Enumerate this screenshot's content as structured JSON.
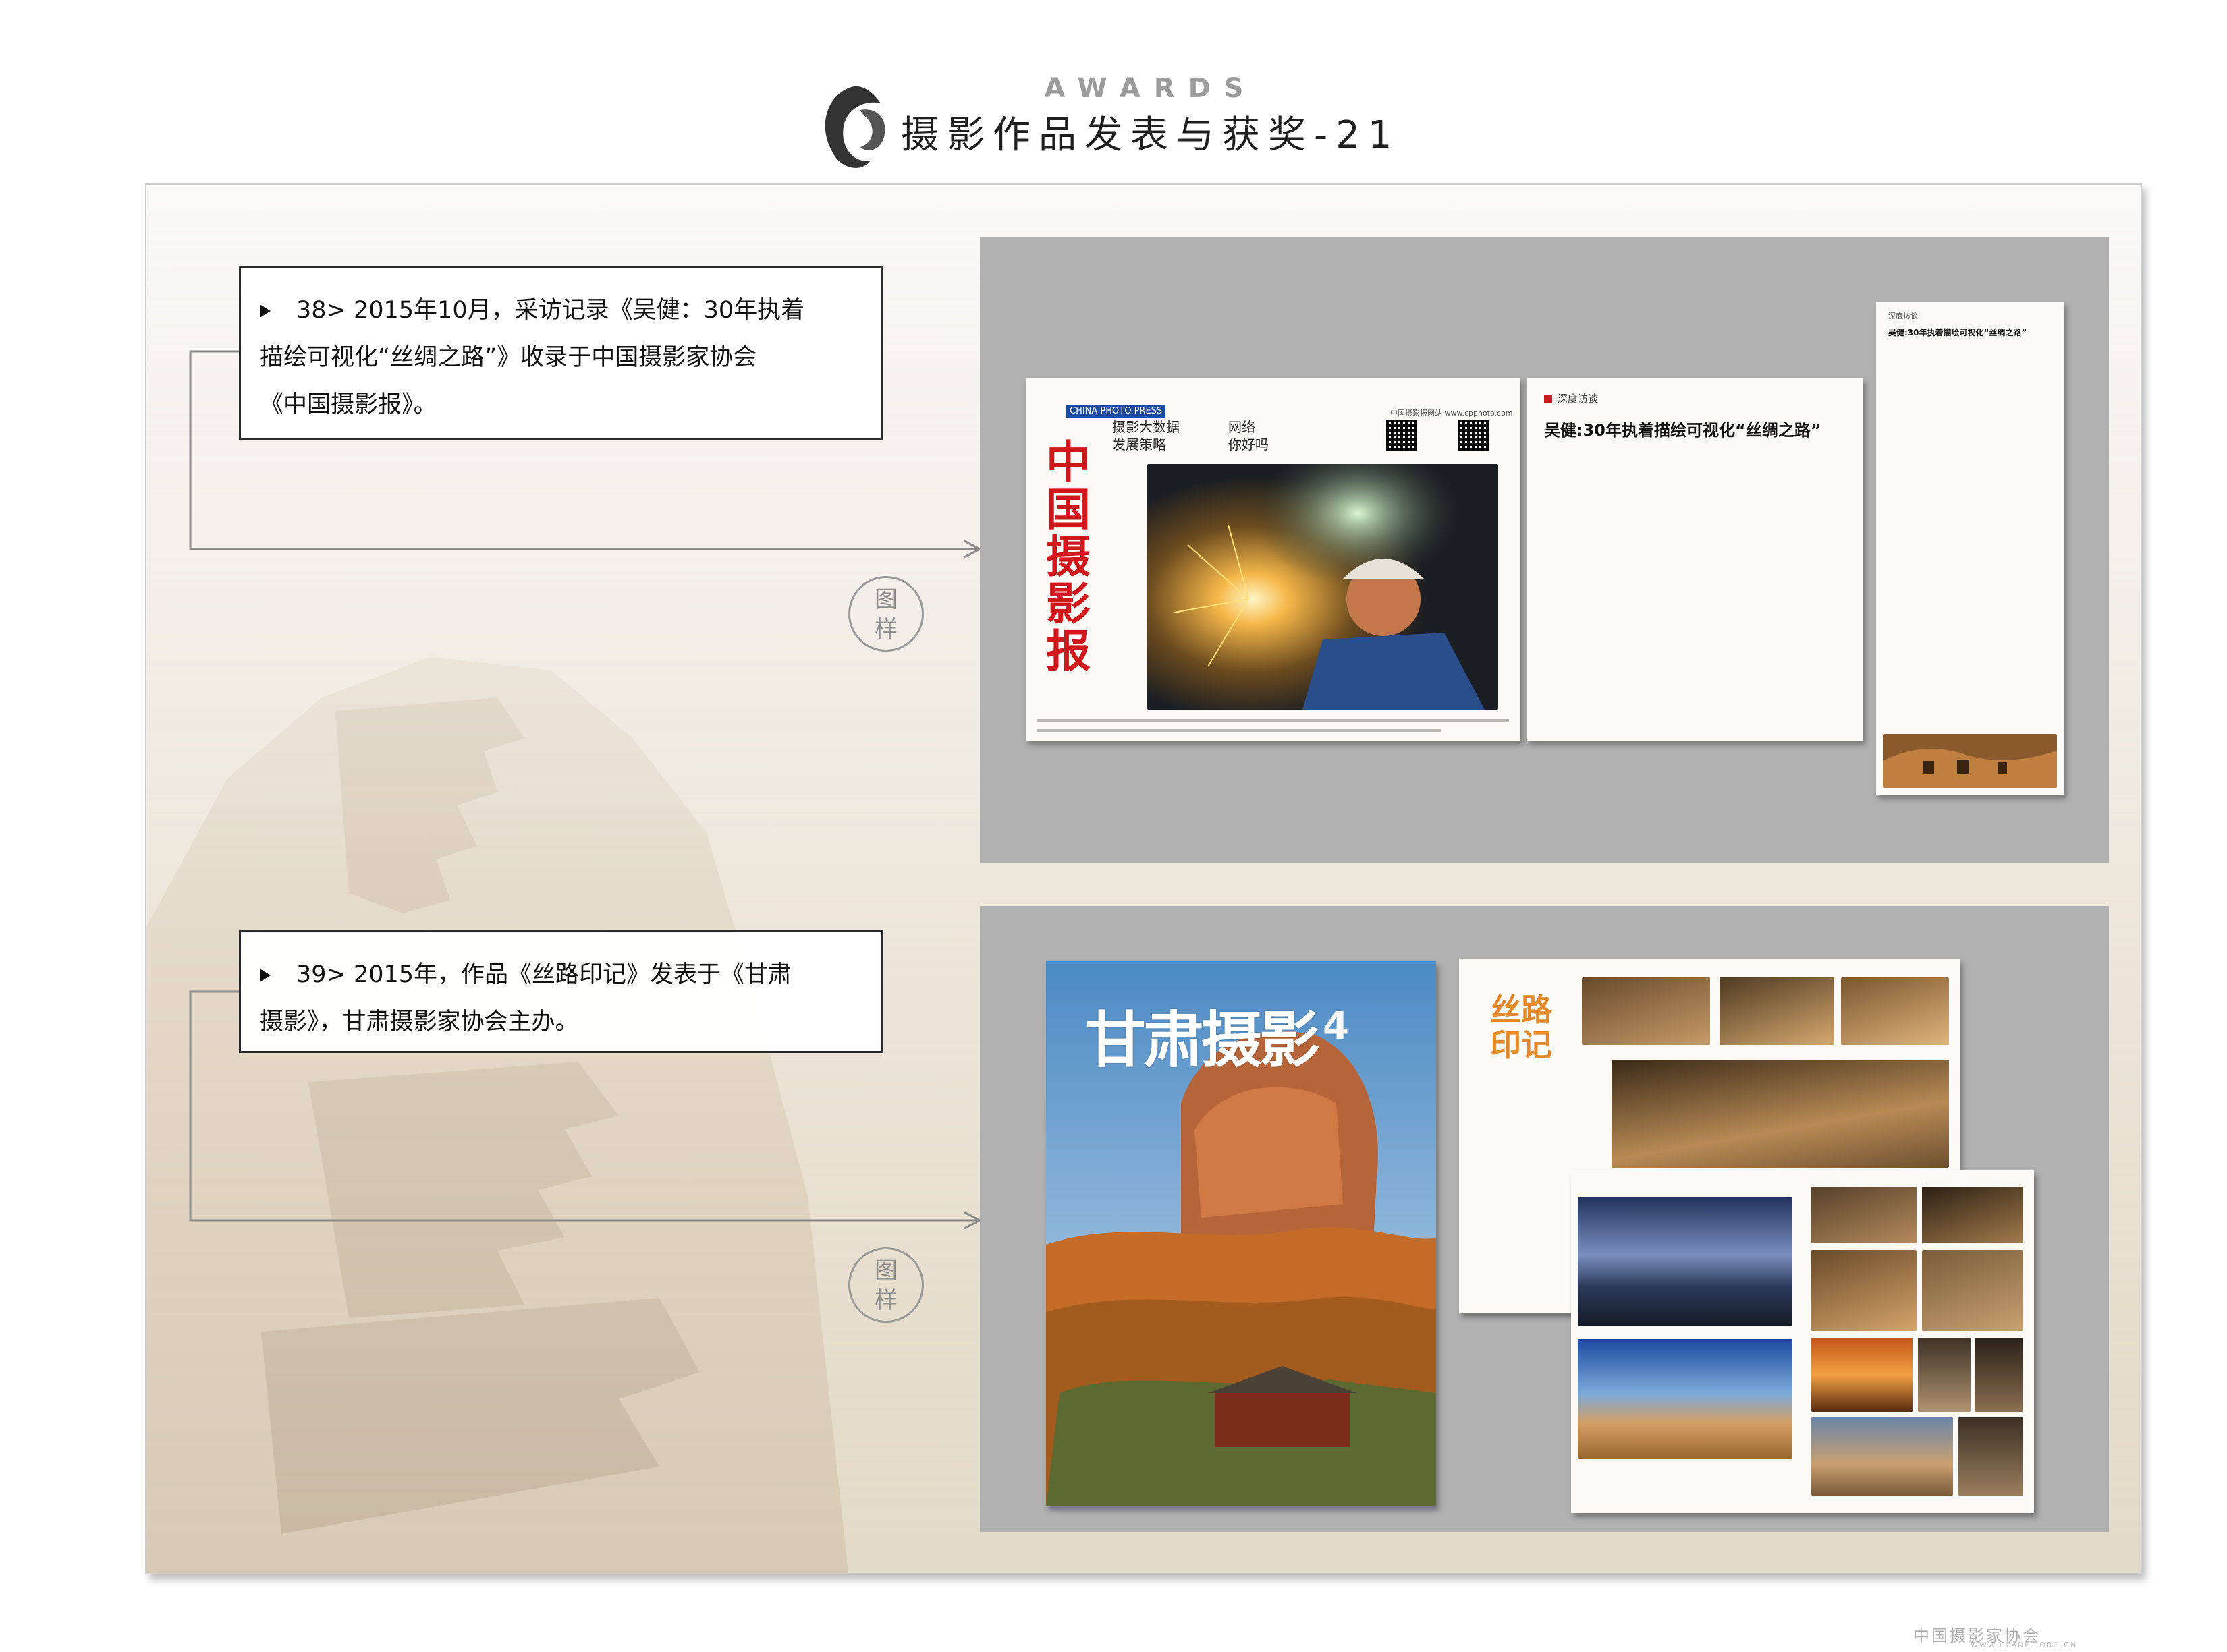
{
  "header": {
    "awards_label": "AWARDS",
    "title": "摄影作品发表与获奖-21"
  },
  "entries": [
    {
      "caption_lines": [
        "38> 2015年10月，采访记录《吴健：30年执着",
        "描绘可视化“丝绸之路”》收录于中国摄影家协会",
        "《中国摄影报》。"
      ],
      "stamp": [
        "图",
        "样"
      ]
    },
    {
      "caption_lines": [
        "39> 2015年，作品《丝路印记》发表于《甘肃",
        "摄影》，甘肃摄影家协会主办。"
      ],
      "stamp": [
        "图",
        "样"
      ]
    }
  ],
  "newspaper": {
    "masthead": "中国摄影报",
    "brand": "CHINA PHOTO PRESS",
    "headline_1": "摄影大数据\n发展策略",
    "headline_2": "网络\n你好吗",
    "site": "中国摄影报网站 www.cpphoto.com"
  },
  "article": {
    "tag": "深度访谈",
    "title": "吴健:30年执着描绘可视化“丝绸之路”",
    "right_tag": "深度访谈",
    "right_title": "吴健:30年执着描绘可视化“丝绸之路”"
  },
  "magazine": {
    "cover_title": "甘肃摄影",
    "issue": "4",
    "spread_title": "丝路\n印记"
  },
  "footer": {
    "mark": "中国摄影家协会",
    "url": "WWW.CPANET.ORG.CN"
  },
  "colors": {
    "panel_gray": "#b1b1b1",
    "masthead_red": "#d0181c",
    "spread_orange": "#e4892b"
  }
}
